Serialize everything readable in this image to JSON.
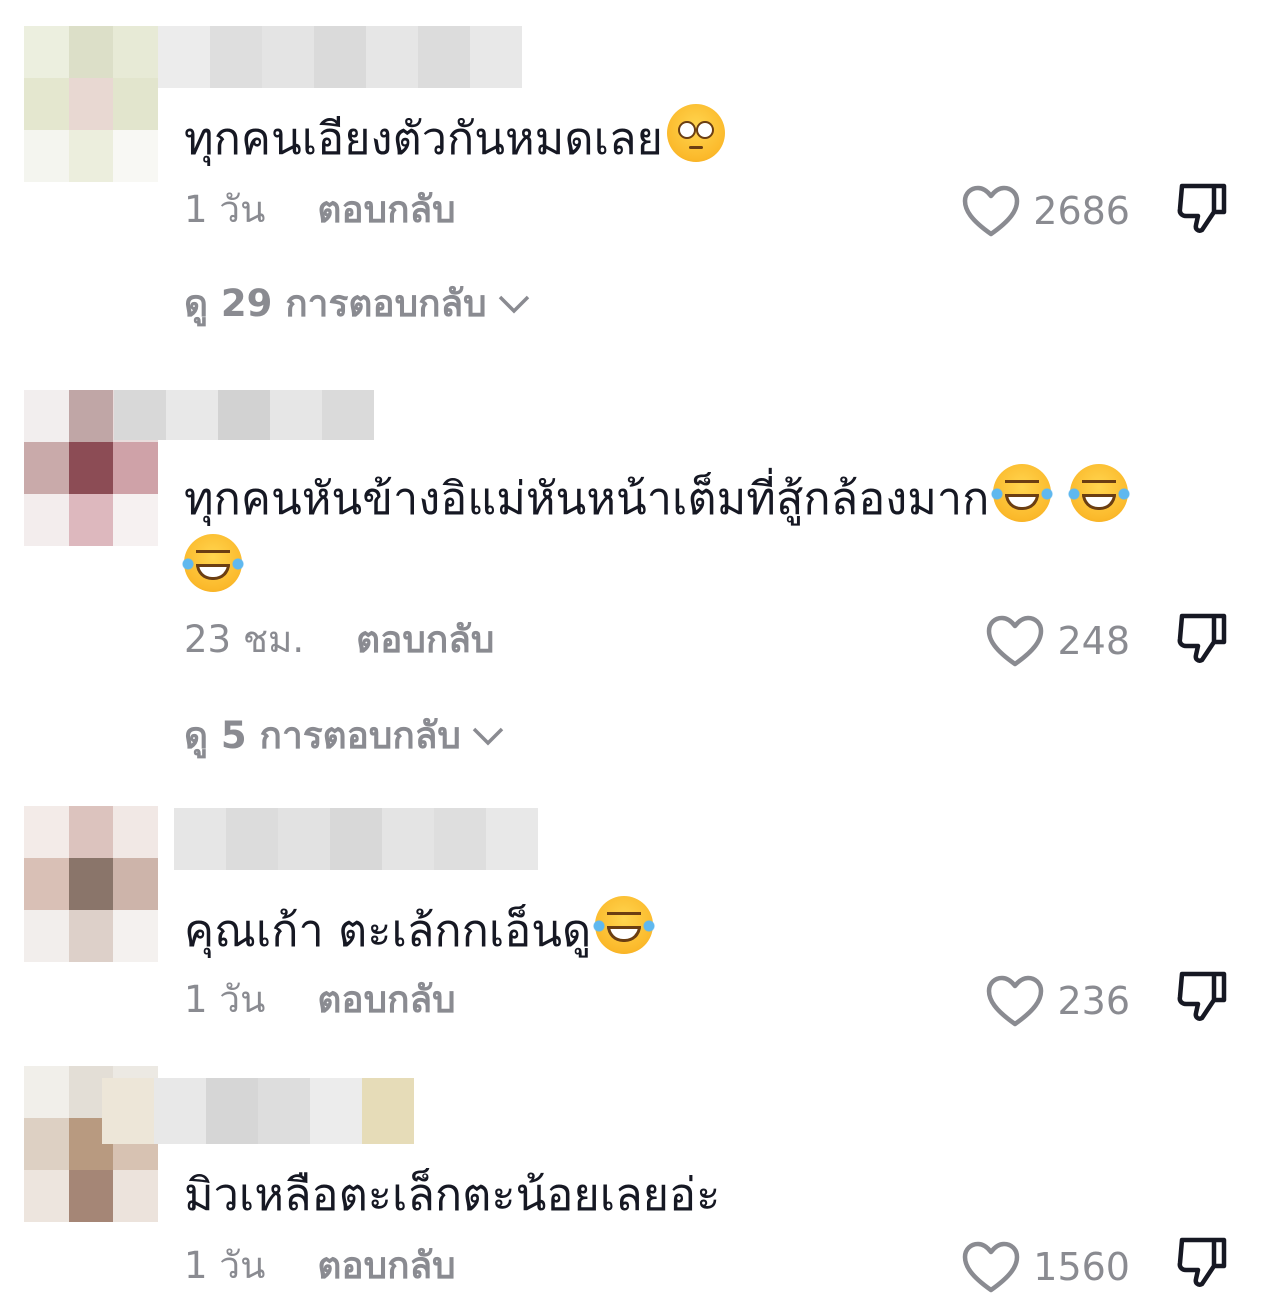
{
  "comments": [
    {
      "text": "ทุกคนเอียงตัวกันหมดเลย",
      "emojis": [
        "flushed-face"
      ],
      "time": "1 วัน",
      "reply_label": "ตอบกลับ",
      "likes": "2686",
      "view_replies": "ดู 29 การตอบกลับ"
    },
    {
      "text": "ทุกคนหันข้างอิแม่หันหน้าเต็มที่สู้กล้องมาก",
      "emojis": [
        "face-with-tears-of-joy",
        "face-with-tears-of-joy",
        "face-with-tears-of-joy"
      ],
      "time": "23 ชม.",
      "reply_label": "ตอบกลับ",
      "likes": "248",
      "view_replies": "ดู 5 การตอบกลับ"
    },
    {
      "text": "คุณเก้า ตะเล้กกเอ็นดู",
      "emojis": [
        "face-with-tears-of-joy"
      ],
      "time": "1 วัน",
      "reply_label": "ตอบกลับ",
      "likes": "236"
    },
    {
      "text": "มิวเหลือตะเล็กตะน้อยเลยอ่ะ",
      "emojis": [],
      "time": "1 วัน",
      "reply_label": "ตอบกลับ",
      "likes": "1560"
    }
  ],
  "colors": {
    "text": "#161823",
    "meta": "#8a8b91",
    "background": "#ffffff"
  }
}
